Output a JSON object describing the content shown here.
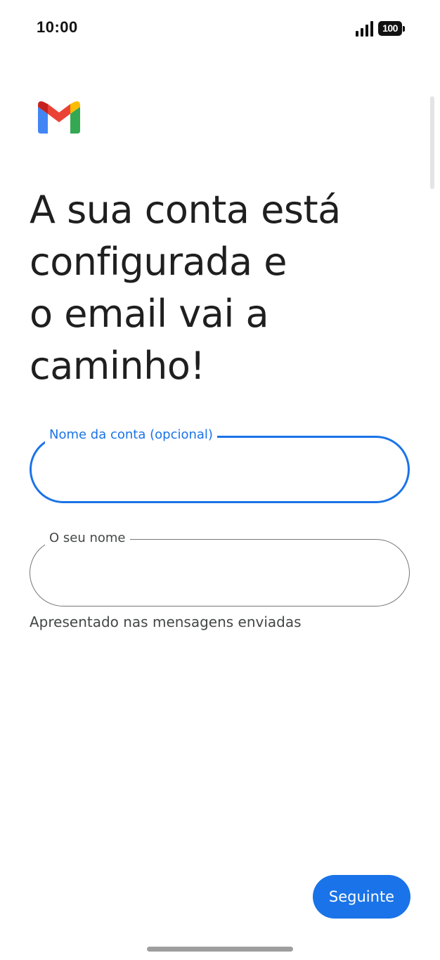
{
  "status_bar": {
    "time": "10:00",
    "battery_level": "100",
    "signal_icon": "cellular-signal-icon"
  },
  "app": {
    "logo": "gmail-logo-icon",
    "colors": {
      "primary": "#1a73e8",
      "text": "#1f1f1f",
      "outline": "#747775",
      "logo_red": "#ea4335",
      "logo_blue": "#4285f4",
      "logo_green": "#34a853",
      "logo_yellow": "#fbbc04",
      "logo_darkred": "#c5221f"
    }
  },
  "main": {
    "title_lines": [
      "A sua conta está",
      "configurada e",
      "o email vai a",
      "caminho!"
    ],
    "account_name_field": {
      "label": "Nome da conta (opcional)",
      "value": ""
    },
    "your_name_field": {
      "label": "O seu nome",
      "value": "",
      "helper": "Apresentado nas mensagens enviadas"
    },
    "next_button": {
      "label": "Seguinte"
    }
  }
}
